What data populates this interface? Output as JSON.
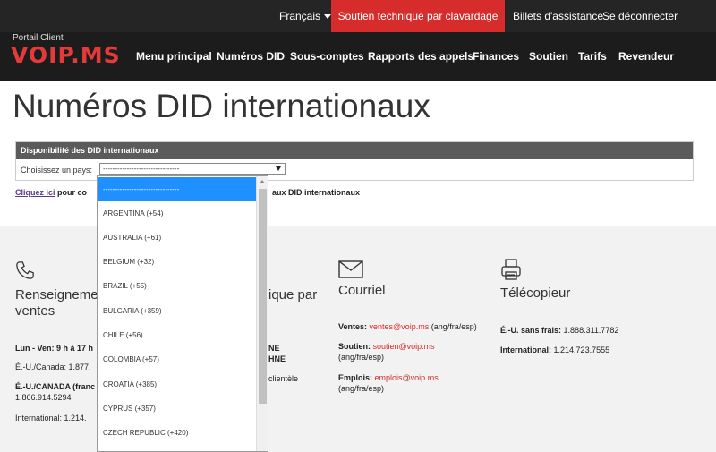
{
  "topbar": {
    "language": "Français",
    "chat_button": "Soutien technique par clavardage",
    "tickets": "Billets d'assistance",
    "logout": "Se déconnecter"
  },
  "brand": {
    "portal_label": "Portail Client",
    "logo": "VOIP.MS"
  },
  "nav": [
    "Menu principal",
    "Numéros DID",
    "Sous-comptes",
    "Rapports des appels",
    "Finances",
    "Soutien",
    "Tarifs",
    "Revendeur"
  ],
  "page_title": "Numéros DID internationaux",
  "panel": {
    "heading": "Disponibilité des DID internationaux",
    "choose_label": "Choisissez un pays:",
    "select_value": "--------------------------------"
  },
  "link_line": {
    "link_text": "Cliquez ici",
    "text_start": "pour co",
    "text_end": "aux DID internationaux"
  },
  "dropdown_options": [
    "--------------------------------",
    "ARGENTINA (+54)",
    "AUSTRALIA (+61)",
    "BELGIUM (+32)",
    "BRAZIL (+55)",
    "BULGARIA (+359)",
    "CHILE (+56)",
    "COLOMBIA (+57)",
    "CROATIA (+385)",
    "CYPRUS (+357)",
    "CZECH REPUBLIC (+420)"
  ],
  "footer": {
    "sales": {
      "title": "Renseignements ventes",
      "hours": "Lun - Ven: 9 h à 17 h",
      "us_ca": "É.-U./Canada: 1.877.",
      "us_ca_fr": "É.-U./CANADA (franc",
      "us_ca_fr_number": "1.866.914.5294",
      "international": "International: 1.214."
    },
    "support": {
      "title": "ique par",
      "line1": "NE",
      "line2": "HNE",
      "line3": "clientèle"
    },
    "email": {
      "title": "Courriel",
      "sales_label": "Ventes:",
      "sales_email": "ventes@voip.ms",
      "sales_lang": "(ang/fra/esp)",
      "support_label": "Soutien:",
      "support_email": "soutien@voip.ms",
      "support_lang": "(ang/fra/esp)",
      "jobs_label": "Emplois:",
      "jobs_email": "emplois@voip.ms",
      "jobs_lang": "(ang/fra/esp)"
    },
    "fax": {
      "title": "Télécopieur",
      "tollfree_label": "É.-U. sans frais:",
      "tollfree_number": "1.888.311.7782",
      "intl_label": "International:",
      "intl_number": "1.214.723.7555"
    }
  },
  "colors": {
    "accent_red": "#d62c2c",
    "topbar": "#252525",
    "navbar": "#1c1c1c",
    "selected_option": "#1e90ff"
  }
}
